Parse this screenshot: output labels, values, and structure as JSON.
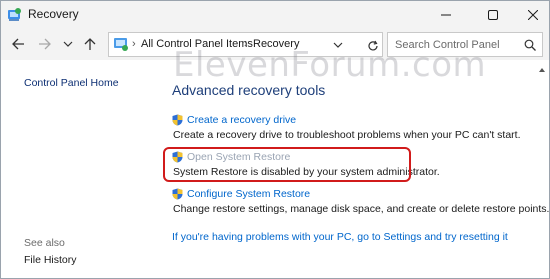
{
  "window": {
    "title": "Recovery"
  },
  "nav": {
    "breadcrumbs": [
      "All Control Panel Items",
      "Recovery"
    ],
    "search_placeholder": "Search Control Panel"
  },
  "left_panel": {
    "home": "Control Panel Home",
    "see_also_label": "See also",
    "file_history": "File History"
  },
  "main": {
    "heading": "Advanced recovery tools",
    "tasks": [
      {
        "link": "Create a recovery drive",
        "description": "Create a recovery drive to troubleshoot problems when your PC can't start."
      },
      {
        "link": "Open System Restore",
        "description": "System Restore is disabled by your system administrator."
      },
      {
        "link": "Configure System Restore",
        "description": "Change restore settings, manage disk space, and create or delete restore points."
      }
    ],
    "reset_link": "If you're having problems with your PC, go to Settings and try resetting it"
  },
  "watermark": "ElevenForum.com",
  "colors": {
    "link": "#0066cc",
    "heading": "#1e3f7a",
    "highlight": "#d11b1b",
    "disabled": "#9aa4b3"
  }
}
